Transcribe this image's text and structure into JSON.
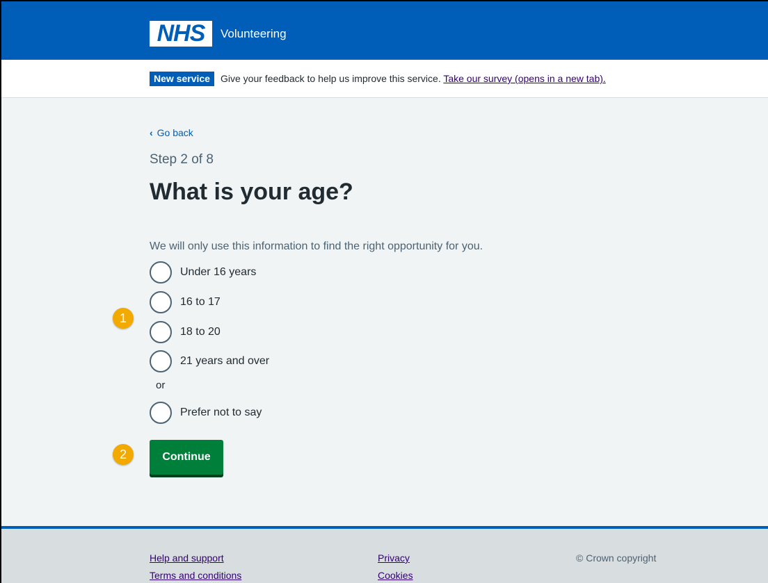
{
  "header": {
    "logo_text": "NHS",
    "service_name": "Volunteering"
  },
  "phase_banner": {
    "tag": "New service",
    "text": "Give your feedback to help us improve this service.",
    "link": "Take our survey (opens in a new tab)."
  },
  "main": {
    "back_link": "Go back",
    "step": "Step 2 of 8",
    "title": "What is your age?",
    "hint": "We will only use this information to find the right opportunity for you.",
    "options": [
      "Under 16 years",
      "16 to 17",
      "18 to 20",
      "21 years and over",
      "Prefer not to say"
    ],
    "divider": "or",
    "continue_label": "Continue"
  },
  "markers": [
    "1",
    "2"
  ],
  "footer": {
    "links": [
      "Help and support",
      "Terms and conditions",
      "Privacy",
      "Cookies"
    ],
    "copyright": "© Crown copyright"
  },
  "colors": {
    "nhs_blue": "#005eb8",
    "button_green": "#007f3b",
    "marker_orange": "#f2a900",
    "page_background": "#f0f4f5"
  }
}
